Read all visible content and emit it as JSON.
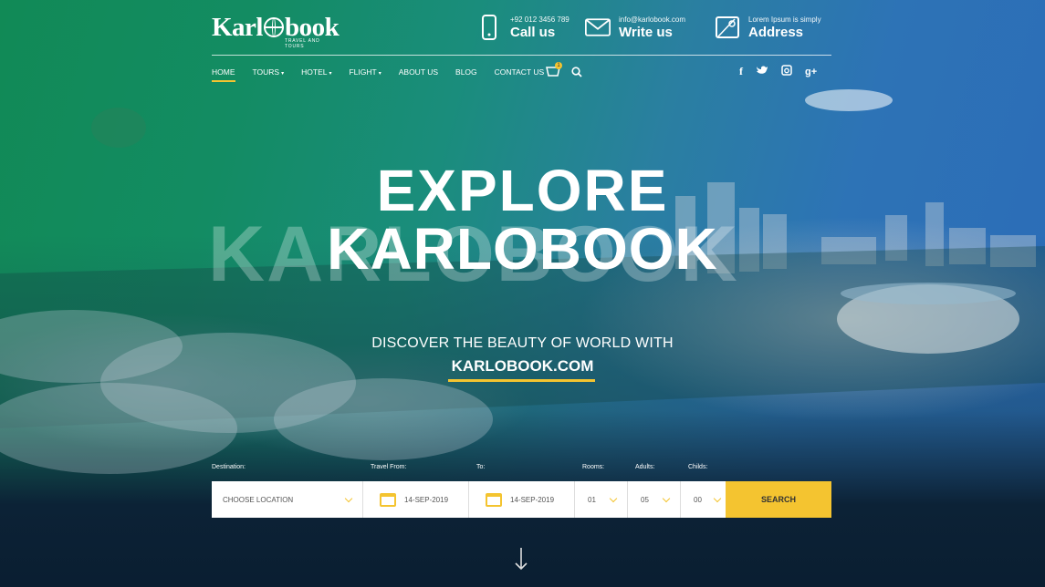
{
  "brand": {
    "name_left": "Karl",
    "name_right": "book",
    "tagline": "TRAVEL AND TOURS"
  },
  "contacts": [
    {
      "icon": "phone-icon",
      "small": "+92 012 3456 789",
      "big": "Call us"
    },
    {
      "icon": "mail-icon",
      "small": "info@karlobook.com",
      "big": "Write us"
    },
    {
      "icon": "map-icon",
      "small": "Lorem Ipsum is simply",
      "big": "Address"
    }
  ],
  "nav": {
    "items": [
      {
        "label": "HOME",
        "dropdown": false,
        "active": true
      },
      {
        "label": "TOURS",
        "dropdown": true
      },
      {
        "label": "HOTEL",
        "dropdown": true
      },
      {
        "label": "FLIGHT",
        "dropdown": true
      },
      {
        "label": "ABOUT US",
        "dropdown": false
      },
      {
        "label": "BLOG",
        "dropdown": false
      },
      {
        "label": "CONTACT US",
        "dropdown": false
      }
    ],
    "cart_count": "1",
    "social": [
      {
        "icon": "facebook-icon",
        "glyph": "f"
      },
      {
        "icon": "twitter-icon",
        "glyph": "t"
      },
      {
        "icon": "instagram-icon",
        "glyph": "◙"
      },
      {
        "icon": "google-plus-icon",
        "glyph": "g+"
      }
    ]
  },
  "hero": {
    "watermark": "KARLOBOOK",
    "title_line1": "EXPLORE",
    "title_line2": "KARLOBOOK",
    "subtitle": "DISCOVER THE BEAUTY OF WORLD WITH",
    "site": "KARLOBOOK.COM"
  },
  "search": {
    "labels": {
      "destination": "Destination:",
      "from": "Travel From:",
      "to": "To:",
      "rooms": "Rooms:",
      "adults": "Adults:",
      "childs": "Childs:"
    },
    "destination_value": "CHOOSE LOCATION",
    "from_value": "14-SEP-2019",
    "to_value": "14-SEP-2019",
    "rooms_value": "01",
    "adults_value": "05",
    "childs_value": "00",
    "button": "SEARCH"
  },
  "colors": {
    "accent": "#f4c430",
    "dark": "#0a1e31"
  }
}
